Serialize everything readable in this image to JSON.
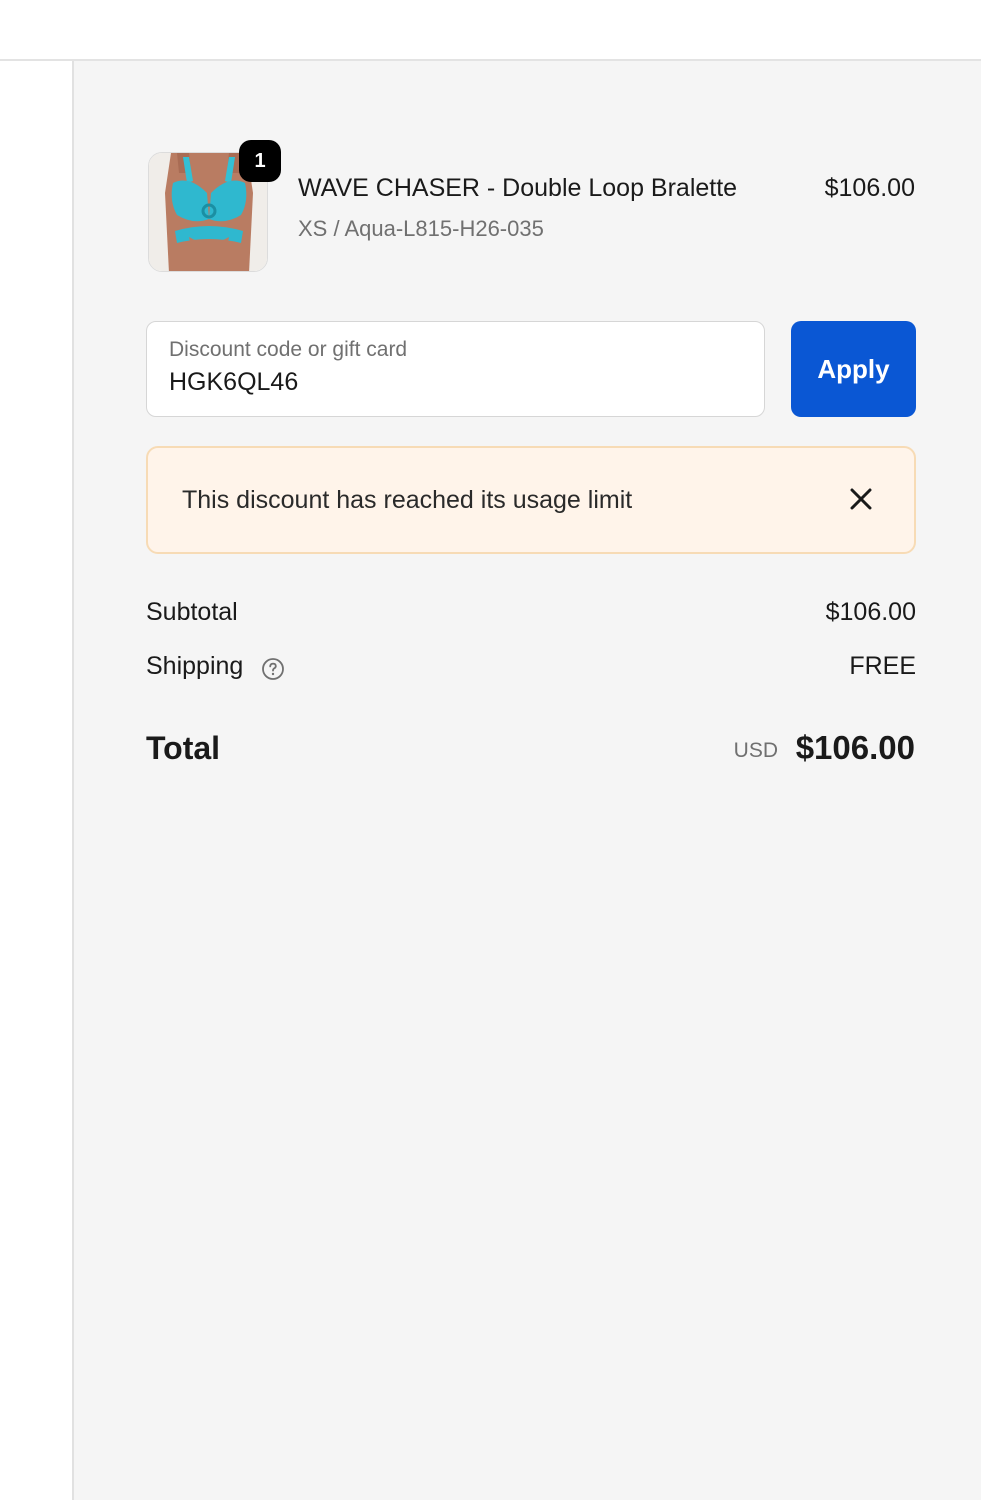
{
  "product": {
    "name": "WAVE CHASER - Double Loop Bralette",
    "variant": "XS / Aqua-L815-H26-035",
    "price": "$106.00",
    "quantity": "1",
    "image_icon": "swimwear-top-thumbnail"
  },
  "discount": {
    "label": "Discount code or gift card",
    "value": "HGK6QL46",
    "apply_label": "Apply"
  },
  "banner": {
    "message": "This discount has reached its usage limit",
    "close_icon": "close-icon"
  },
  "summary": {
    "subtotal_label": "Subtotal",
    "subtotal_value": "$106.00",
    "shipping_label": "Shipping",
    "shipping_value": "FREE",
    "total_label": "Total",
    "currency": "USD",
    "total_value": "$106.00"
  },
  "colors": {
    "accent": "#0a57d4",
    "banner_bg": "#fff4ea",
    "banner_border": "#f7dbb5",
    "pane_bg": "#f5f5f5"
  }
}
